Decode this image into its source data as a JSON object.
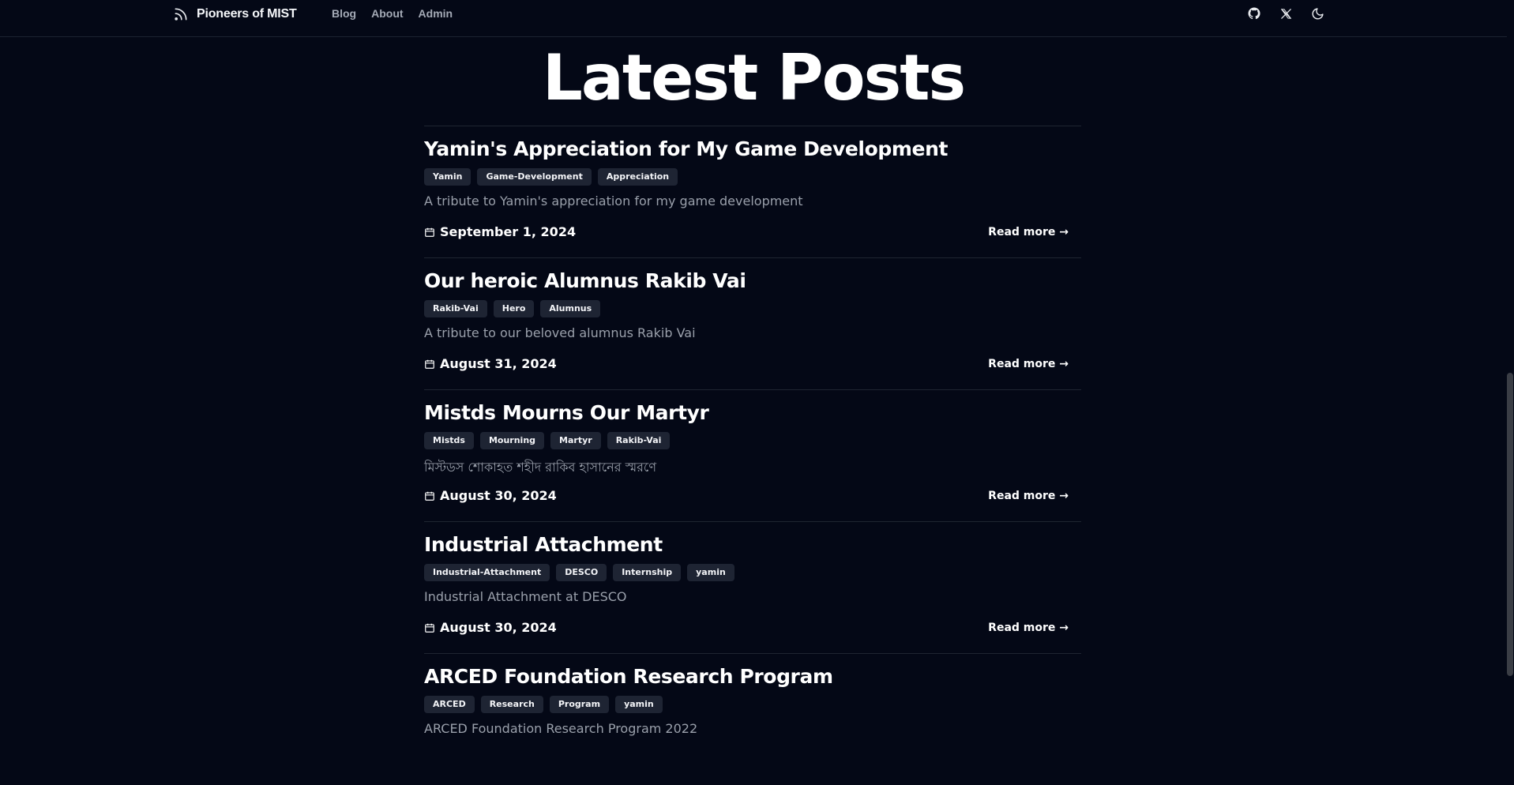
{
  "header": {
    "brand": "Pioneers of MIST",
    "nav": [
      {
        "label": "Blog"
      },
      {
        "label": "About"
      },
      {
        "label": "Admin"
      }
    ],
    "icons": [
      "github-icon",
      "x-icon",
      "moon-icon"
    ]
  },
  "main": {
    "title": "Latest Posts",
    "read_more_label": "Read more →",
    "posts": [
      {
        "title": "Yamin's Appreciation for My Game Development",
        "tags": [
          "Yamin",
          "Game-Development",
          "Appreciation"
        ],
        "description": "A tribute to Yamin's appreciation for my game development",
        "date": "September 1, 2024"
      },
      {
        "title": "Our heroic Alumnus Rakib Vai",
        "tags": [
          "Rakib-Vai",
          "Hero",
          "Alumnus"
        ],
        "description": "A tribute to our beloved alumnus Rakib Vai",
        "date": "August 31, 2024"
      },
      {
        "title": "Mistds Mourns Our Martyr",
        "tags": [
          "Mistds",
          "Mourning",
          "Martyr",
          "Rakib-Vai"
        ],
        "description": "মিস্টডস শোকাহত শহীদ রাকিব হাসানের স্মরণে",
        "date": "August 30, 2024"
      },
      {
        "title": "Industrial Attachment",
        "tags": [
          "Industrial-Attachment",
          "DESCO",
          "Internship",
          "yamin"
        ],
        "description": "Industrial Attachment at DESCO",
        "date": "August 30, 2024"
      },
      {
        "title": "ARCED Foundation Research Program",
        "tags": [
          "ARCED",
          "Research",
          "Program",
          "yamin"
        ],
        "description": "ARCED Foundation Research Program 2022",
        "date": ""
      }
    ]
  },
  "colors": {
    "background": "#040816",
    "tag_bg": "#1e2433",
    "muted_text": "#9aa0ab",
    "nav_text": "#a4aab6"
  }
}
